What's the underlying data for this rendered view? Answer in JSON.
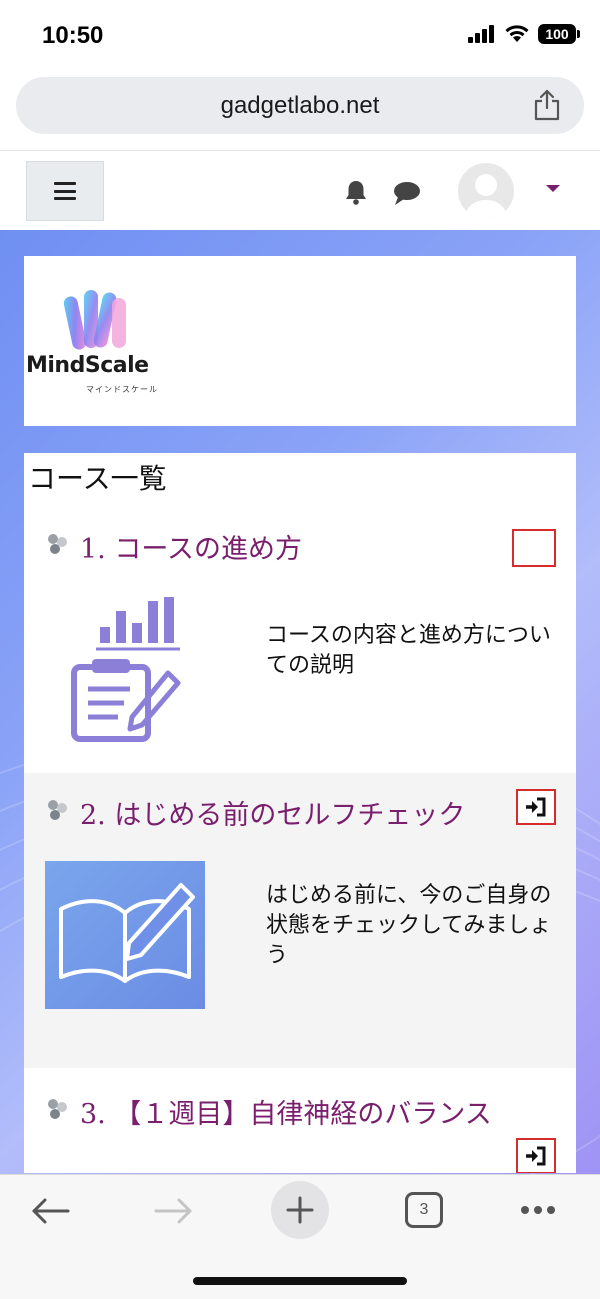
{
  "status_bar": {
    "time": "10:50",
    "battery": "100"
  },
  "browser": {
    "url": "gadgetlabo.net",
    "tab_count": "3"
  },
  "site": {
    "logo_text": "MindScale",
    "logo_sub": "マインドスケール",
    "course_list_heading": "コース一覧",
    "sections": [
      {
        "title": "1. コースの進め方",
        "description": "コースの内容と進め方についての説明"
      },
      {
        "title": "2. はじめる前のセルフチェック",
        "description": "はじめる前に、今のご自身の状態をチェックしてみましょう"
      },
      {
        "title": "3. 【１週目】自律神経のバランス",
        "description": ""
      }
    ]
  },
  "colors": {
    "section_title": "#7a1f6e",
    "status_border": "#d62c2c",
    "bg_gradient_start": "#6f8ff2",
    "bg_gradient_end": "#9f93f4"
  }
}
